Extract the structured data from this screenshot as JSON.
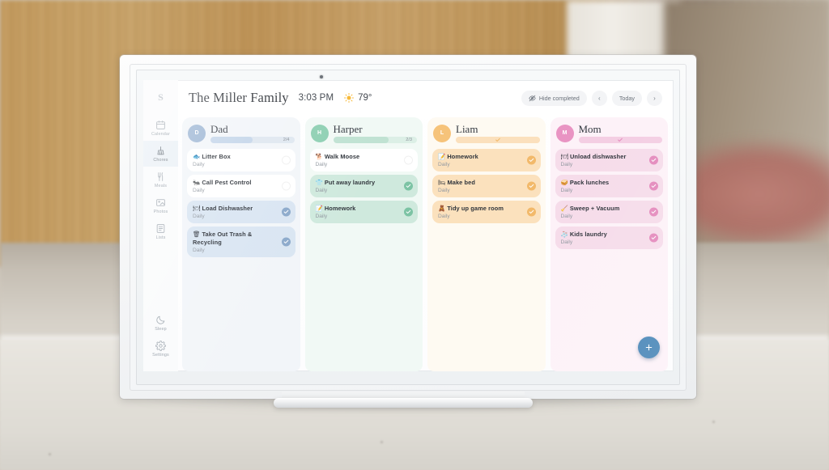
{
  "app": {
    "logo": "S",
    "title": "The Miller Family",
    "time": "3:03 PM",
    "temperature": "79°"
  },
  "sidebar": {
    "items": [
      {
        "label": "Calendar",
        "icon": "calendar-icon",
        "active": false
      },
      {
        "label": "Chores",
        "icon": "broom-icon",
        "active": true
      },
      {
        "label": "Meals",
        "icon": "cutlery-icon",
        "active": false
      },
      {
        "label": "Photos",
        "icon": "photo-icon",
        "active": false
      },
      {
        "label": "Lists",
        "icon": "list-icon",
        "active": false
      }
    ],
    "bottom_items": [
      {
        "label": "Sleep",
        "icon": "moon-icon",
        "active": false
      },
      {
        "label": "Settings",
        "icon": "gear-icon",
        "active": false
      }
    ]
  },
  "header": {
    "hide_completed_label": "Hide completed",
    "hide_completed_icon": "eye-slash-icon",
    "prev_label": "‹",
    "today_label": "Today",
    "next_label": "›"
  },
  "fab": {
    "label": "+",
    "icon": "plus-icon",
    "color": "#4a87b8"
  },
  "columns": [
    {
      "name": "Dad",
      "initial": "D",
      "accent": "#8aa8ca",
      "avatar_color": "#9db6d4",
      "column_bg": "#f2f5f9",
      "task_bg": "#ffffff",
      "task_done_bg": "#d9e5f2",
      "bar_bg": "#dfe7f0",
      "bar_fill": "#c5d6ea",
      "progress_text": "2/4",
      "progress_pct": 50,
      "tasks": [
        {
          "emoji": "🐟",
          "title": "Litter Box",
          "schedule": "Daily",
          "done": false
        },
        {
          "emoji": "🐜",
          "title": "Call Pest Control",
          "schedule": "Daily",
          "done": false
        },
        {
          "emoji": "🍽",
          "title": "Load Dishwasher",
          "schedule": "Daily",
          "done": true
        },
        {
          "emoji": "🗑",
          "title": "Take Out Trash & Recycling",
          "schedule": "Daily",
          "done": true
        }
      ]
    },
    {
      "name": "Harper",
      "initial": "H",
      "accent": "#7cc3a4",
      "avatar_color": "#8dcfb2",
      "column_bg": "#f1f9f5",
      "task_bg": "#ffffff",
      "task_done_bg": "#cfe9dd",
      "bar_bg": "#dcefe6",
      "bar_fill": "#bfe2d2",
      "progress_text": "2/3",
      "progress_pct": 66,
      "tasks": [
        {
          "emoji": "🐕",
          "title": "Walk Moose",
          "schedule": "Daily",
          "done": false
        },
        {
          "emoji": "👕",
          "title": "Put away laundry",
          "schedule": "Daily",
          "done": true
        },
        {
          "emoji": "📝",
          "title": "Homework",
          "schedule": "Daily",
          "done": true
        }
      ]
    },
    {
      "name": "Liam",
      "initial": "L",
      "accent": "#f2b96a",
      "avatar_color": "#f6c37a",
      "column_bg": "#fefaf2",
      "task_bg": "#fbe5c5",
      "task_done_bg": "#fbe1bd",
      "bar_bg": "#fbe7cc",
      "bar_fill": "#fbe0bd",
      "progress_text": "",
      "progress_pct": 100,
      "tasks": [
        {
          "emoji": "📝",
          "title": "Homework",
          "schedule": "Daily",
          "done": true
        },
        {
          "emoji": "🛏",
          "title": "Make bed",
          "schedule": "Daily",
          "done": true
        },
        {
          "emoji": "🧸",
          "title": "Tidy up game room",
          "schedule": "Daily",
          "done": true
        }
      ]
    },
    {
      "name": "Mom",
      "initial": "M",
      "accent": "#e48bbd",
      "avatar_color": "#e994c3",
      "column_bg": "#fdf2f8",
      "task_bg": "#f6dcea",
      "task_done_bg": "#f6dcea",
      "bar_bg": "#f7dcec",
      "bar_fill": "#f4cee3",
      "progress_text": "",
      "progress_pct": 100,
      "tasks": [
        {
          "emoji": "🍽",
          "title": "Unload dishwasher",
          "schedule": "Daily",
          "done": true
        },
        {
          "emoji": "🥪",
          "title": "Pack lunches",
          "schedule": "Daily",
          "done": true
        },
        {
          "emoji": "🧹",
          "title": "Sweep + Vacuum",
          "schedule": "Daily",
          "done": true
        },
        {
          "emoji": "🧦",
          "title": "Kids laundry",
          "schedule": "Daily",
          "done": true
        }
      ]
    }
  ]
}
